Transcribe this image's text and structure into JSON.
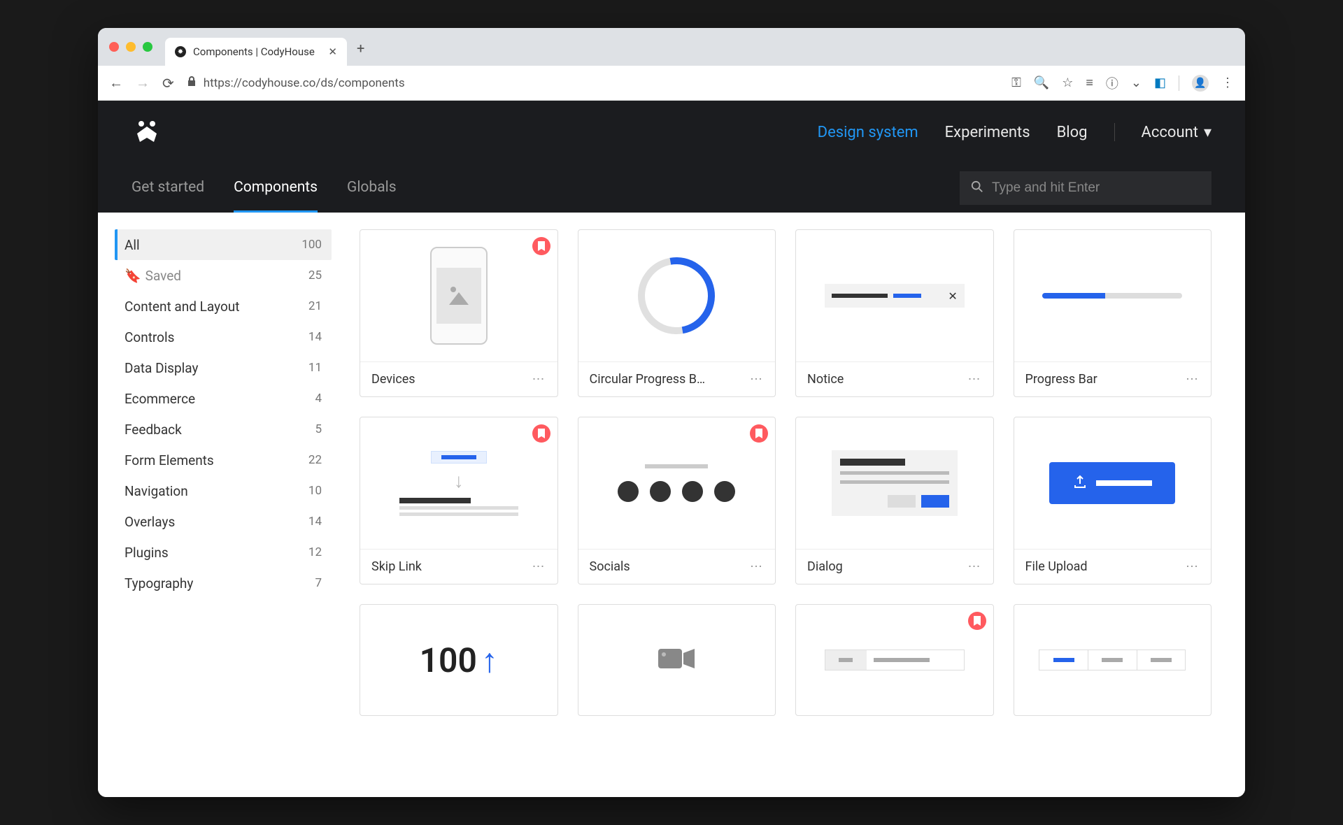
{
  "browser": {
    "tab_title": "Components | CodyHouse",
    "url": "https://codyhouse.co/ds/components"
  },
  "nav": {
    "links": [
      "Design system",
      "Experiments",
      "Blog"
    ],
    "active_index": 0,
    "account_label": "Account"
  },
  "subnav": {
    "items": [
      "Get started",
      "Components",
      "Globals"
    ],
    "active_index": 1
  },
  "search": {
    "placeholder": "Type and hit Enter"
  },
  "sidebar": [
    {
      "label": "All",
      "count": "100",
      "active": true
    },
    {
      "label": "Saved",
      "count": "25",
      "saved": true
    },
    {
      "label": "Content and Layout",
      "count": "21"
    },
    {
      "label": "Controls",
      "count": "14"
    },
    {
      "label": "Data Display",
      "count": "11"
    },
    {
      "label": "Ecommerce",
      "count": "4"
    },
    {
      "label": "Feedback",
      "count": "5"
    },
    {
      "label": "Form Elements",
      "count": "22"
    },
    {
      "label": "Navigation",
      "count": "10"
    },
    {
      "label": "Overlays",
      "count": "14"
    },
    {
      "label": "Plugins",
      "count": "12"
    },
    {
      "label": "Typography",
      "count": "7"
    }
  ],
  "cards": [
    {
      "title": "Devices",
      "bookmarked": true
    },
    {
      "title": "Circular Progress B…"
    },
    {
      "title": "Notice"
    },
    {
      "title": "Progress Bar"
    },
    {
      "title": "Skip Link",
      "bookmarked": true
    },
    {
      "title": "Socials",
      "bookmarked": true
    },
    {
      "title": "Dialog"
    },
    {
      "title": "File Upload"
    }
  ],
  "card_counter": "100"
}
